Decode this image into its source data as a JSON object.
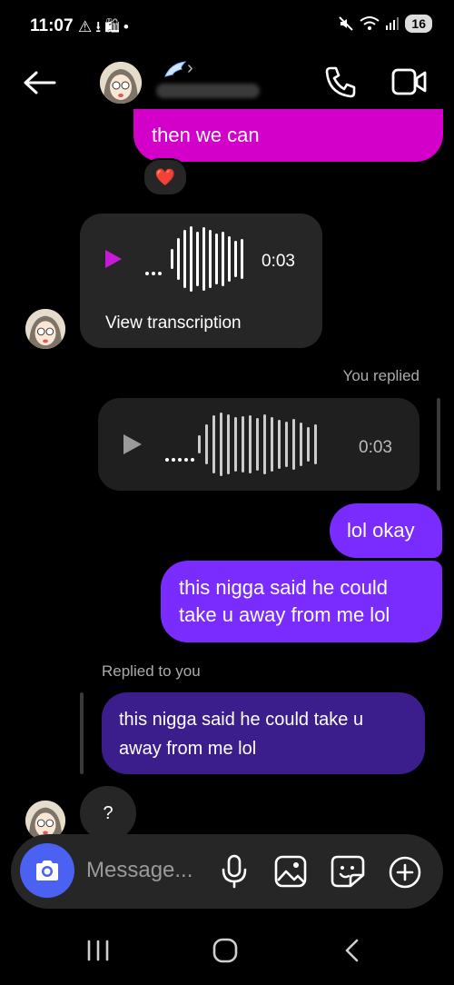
{
  "status_bar": {
    "time": "11:07",
    "battery": "16"
  },
  "chat": {
    "top_message": "then we can",
    "reaction": "❤️",
    "voice_message_in": {
      "duration": "0:03",
      "transcription_link": "View transcription"
    },
    "you_replied_label": "You replied",
    "voice_message_out": {
      "duration": "0:03"
    },
    "msg_lol_okay": "lol okay",
    "msg_outgoing_long_line1": "this nigga said he could",
    "msg_outgoing_long_line2": "take u away from me lol",
    "replied_to_you_label": "Replied to you",
    "quoted_line1": "this nigga said he could take u",
    "quoted_line2": "away from me lol",
    "msg_question": "?"
  },
  "composer": {
    "placeholder": "Message..."
  },
  "colors": {
    "pink_bubble": "#d200c8",
    "purple_bubble": "#7a2cff",
    "quote_bubble": "#3c1d8c",
    "camera_button": "#4b61f2"
  }
}
